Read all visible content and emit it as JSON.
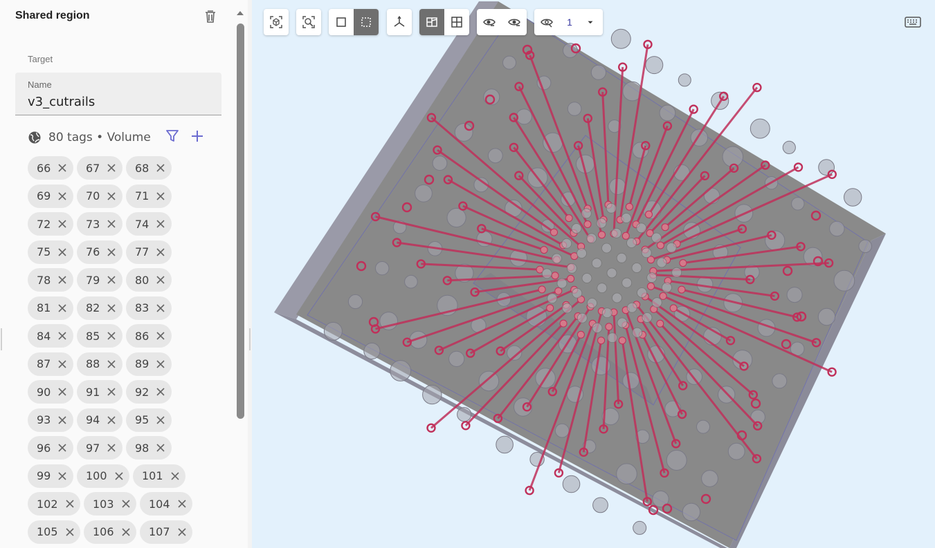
{
  "panel": {
    "title": "Shared region",
    "target_label": "Target",
    "name_label": "Name",
    "name_value": "v3_cutrails",
    "tags_summary": "80 tags • Volume",
    "icons": {
      "delete": "trash-icon",
      "globe": "globe-icon",
      "filter": "filter-icon",
      "add": "plus-icon",
      "chip_remove": "close-icon"
    },
    "tags": [
      "66",
      "67",
      "68",
      "69",
      "70",
      "71",
      "72",
      "73",
      "74",
      "75",
      "76",
      "77",
      "78",
      "79",
      "80",
      "81",
      "82",
      "83",
      "84",
      "85",
      "86",
      "87",
      "88",
      "89",
      "90",
      "91",
      "92",
      "93",
      "94",
      "95",
      "96",
      "97",
      "98",
      "99",
      "100",
      "101",
      "102",
      "103",
      "104",
      "105",
      "106",
      "107"
    ]
  },
  "toolbar": {
    "selection_count": "1",
    "groups": [
      [
        "zoom-selection-icon",
        "zoom-extents-icon"
      ],
      [
        "select-box-icon",
        "select-box-dashed-icon"
      ],
      [
        "axes-icon"
      ],
      [
        "view-3d-icon",
        "view-grid-icon"
      ],
      [
        "show-icon",
        "hide-icon"
      ],
      [
        "visibility-icon",
        "count",
        "dropdown-arrow-icon"
      ]
    ],
    "keyboard_icon": "keyboard-icon"
  },
  "colors": {
    "viewport_bg": "#e3f1fc",
    "accent": "#5b5bc8",
    "trace": "#c0305a",
    "active_button": "#6f6f6f"
  }
}
